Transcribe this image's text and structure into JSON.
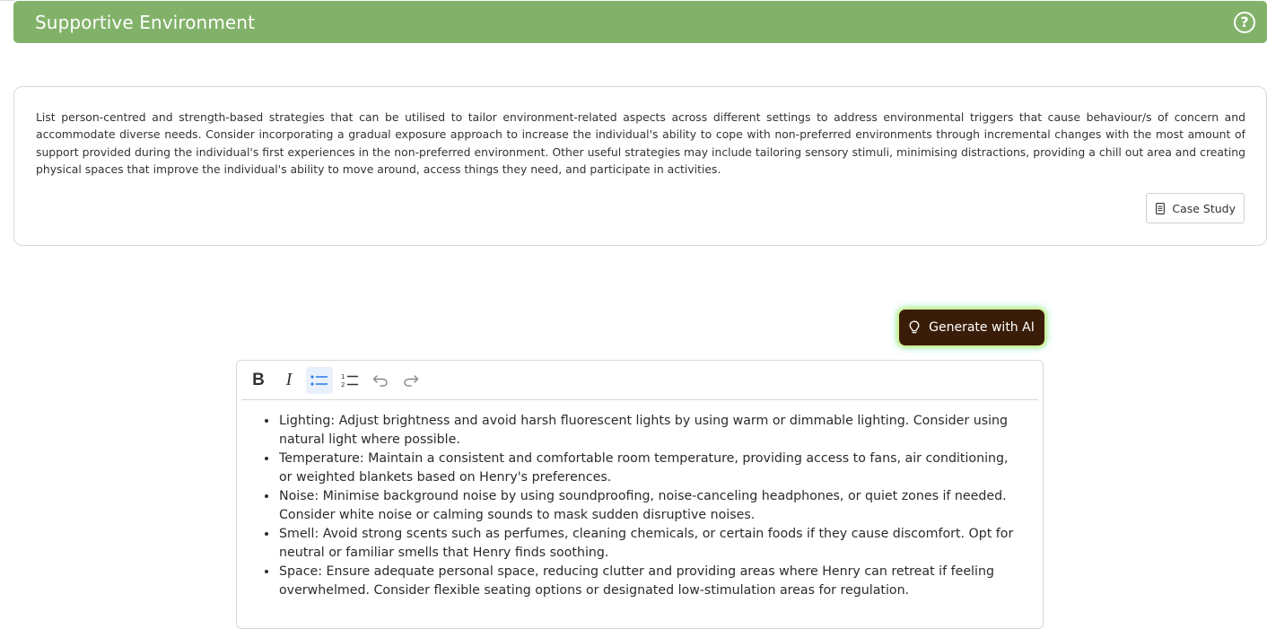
{
  "header": {
    "title": "Supportive Environment",
    "help_icon": "help-circle-icon"
  },
  "info": {
    "description": "List person-centred and strength-based strategies that can be utilised to tailor environment-related aspects across different settings to address environmental triggers that cause behaviour/s of concern and accommodate diverse needs. Consider incorporating a gradual exposure approach to increase the individual's ability to cope with non-preferred environments through incremental changes with the most amount of support provided during the individual's first experiences in the non-preferred environment. Other useful strategies may include tailoring sensory stimuli, minimising distractions, providing a chill out area and creating physical spaces that improve the individual's ability to move around, access things they need, and participate in activities.",
    "case_study_label": "Case Study",
    "case_study_icon": "document-icon"
  },
  "ai": {
    "generate_label": "Generate with AI",
    "icon": "lightbulb-icon"
  },
  "editor": {
    "toolbar": {
      "bold": "B",
      "italic": "I",
      "bullet_list_active": true,
      "ordered_list": "ordered-list-icon",
      "undo": "undo-icon",
      "redo": "redo-icon"
    },
    "items": [
      "Lighting: Adjust brightness and avoid harsh fluorescent lights by using warm or dimmable lighting. Consider using natural light where possible.",
      "Temperature: Maintain a consistent and comfortable room temperature, providing access to fans, air conditioning, or weighted blankets based on Henry's preferences.",
      "Noise: Minimise background noise by using soundproofing, noise-canceling headphones, or quiet zones if needed. Consider white noise or calming sounds to mask sudden disruptive noises.",
      "Smell: Avoid strong scents such as perfumes, cleaning chemicals, or certain foods if they cause discomfort. Opt for neutral or familiar smells that Henry finds soothing.",
      "Space: Ensure adequate personal space, reducing clutter and providing areas where Henry can retreat if feeling overwhelmed. Consider flexible seating options or designated low-stimulation areas for regulation."
    ]
  },
  "colors": {
    "header_bg": "#82b26a",
    "ai_button_bg": "#3a1d08",
    "active_tool_bg": "#e8f0fb",
    "active_tool_icon": "#2f80ed"
  }
}
